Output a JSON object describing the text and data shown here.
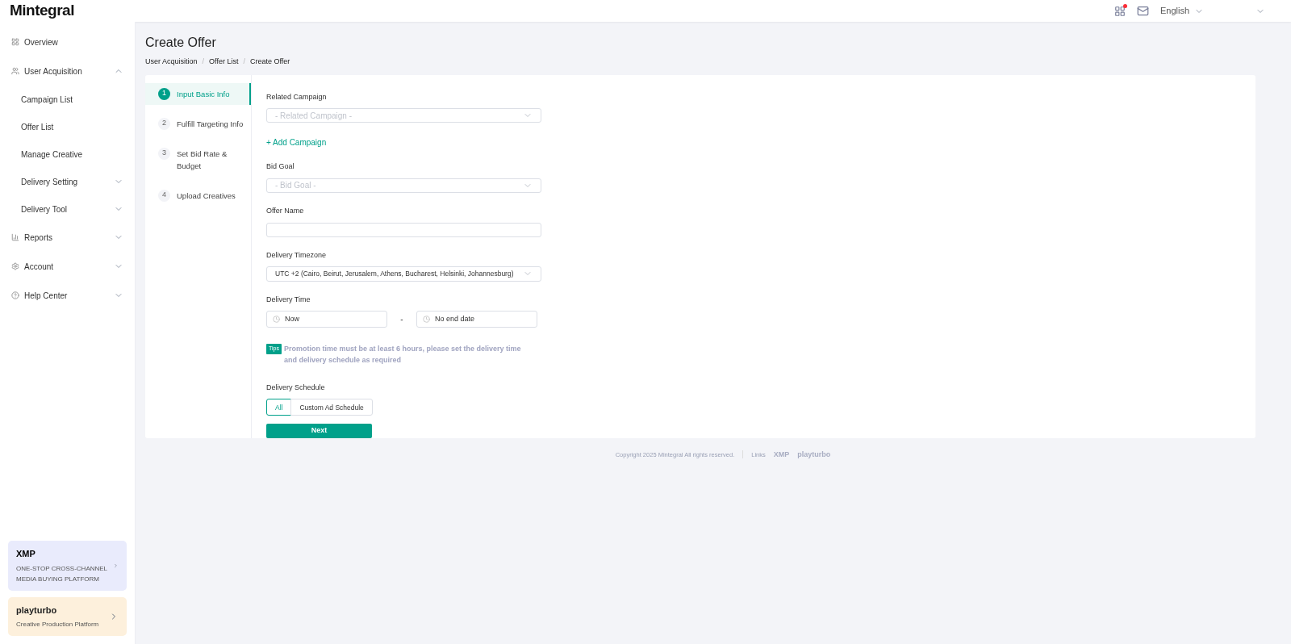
{
  "header": {
    "logo": "Mintegral",
    "apps_notification": true,
    "language": "English"
  },
  "sidebar": {
    "items": [
      {
        "label": "Overview"
      },
      {
        "label": "User Acquisition",
        "expanded": true,
        "children": [
          {
            "label": "Campaign List"
          },
          {
            "label": "Offer List"
          },
          {
            "label": "Manage Creative"
          },
          {
            "label": "Delivery Setting",
            "expanded": false
          },
          {
            "label": "Delivery Tool",
            "expanded": false
          }
        ]
      },
      {
        "label": "Reports",
        "expanded": false
      },
      {
        "label": "Account",
        "expanded": false
      },
      {
        "label": "Help Center",
        "expanded": false
      }
    ],
    "promos": [
      {
        "kind": "xmp",
        "logo": "XMP",
        "text": "ONE-STOP CROSS-CHANNEL MEDIA BUYING PLATFORM"
      },
      {
        "kind": "playturbo",
        "logo": "playturbo",
        "text": "Creative Production Platform"
      }
    ]
  },
  "page": {
    "title": "Create Offer",
    "breadcrumb": [
      "User Acquisition",
      "Offer List",
      "Create Offer"
    ],
    "breadcrumb_separator": "/"
  },
  "steps": [
    {
      "number": "1",
      "label": "Input Basic Info",
      "selected": true
    },
    {
      "number": "2",
      "label": "Fulfill Targeting Info",
      "selected": false
    },
    {
      "number": "3",
      "label": "Set Bid Rate & Budget",
      "selected": false
    },
    {
      "number": "4",
      "label": "Upload Creatives",
      "selected": false
    }
  ],
  "form": {
    "related_campaign": {
      "label": "Related Campaign",
      "placeholder": "- Related Campaign -"
    },
    "add_campaign": "+ Add Campaign",
    "bid_goal": {
      "label": "Bid Goal",
      "placeholder": "- Bid Goal -"
    },
    "offer_name": {
      "label": "Offer Name"
    },
    "timezone": {
      "label": "Delivery Timezone",
      "value": "UTC +2 (Cairo, Beirut, Jerusalem, Athens, Bucharest, Helsinki, Johannesburg)"
    },
    "delivery_time": {
      "label": "Delivery Time",
      "start": "Now",
      "separator": "-",
      "end": "No end date"
    },
    "tip": {
      "badge": "Tips",
      "text": "Promotion time must be at least 6 hours, please set the delivery time and delivery schedule as required"
    },
    "schedule": {
      "label": "Delivery Schedule",
      "options": [
        {
          "label": "All",
          "selected": true
        },
        {
          "label": "Custom Ad Schedule",
          "selected": false
        }
      ]
    },
    "next": "Next"
  },
  "footer": {
    "copyright": "Copyright 2025 Mintegral All rights reserved.",
    "links_label": "Links",
    "links": [
      "XMP",
      "playturbo"
    ]
  }
}
